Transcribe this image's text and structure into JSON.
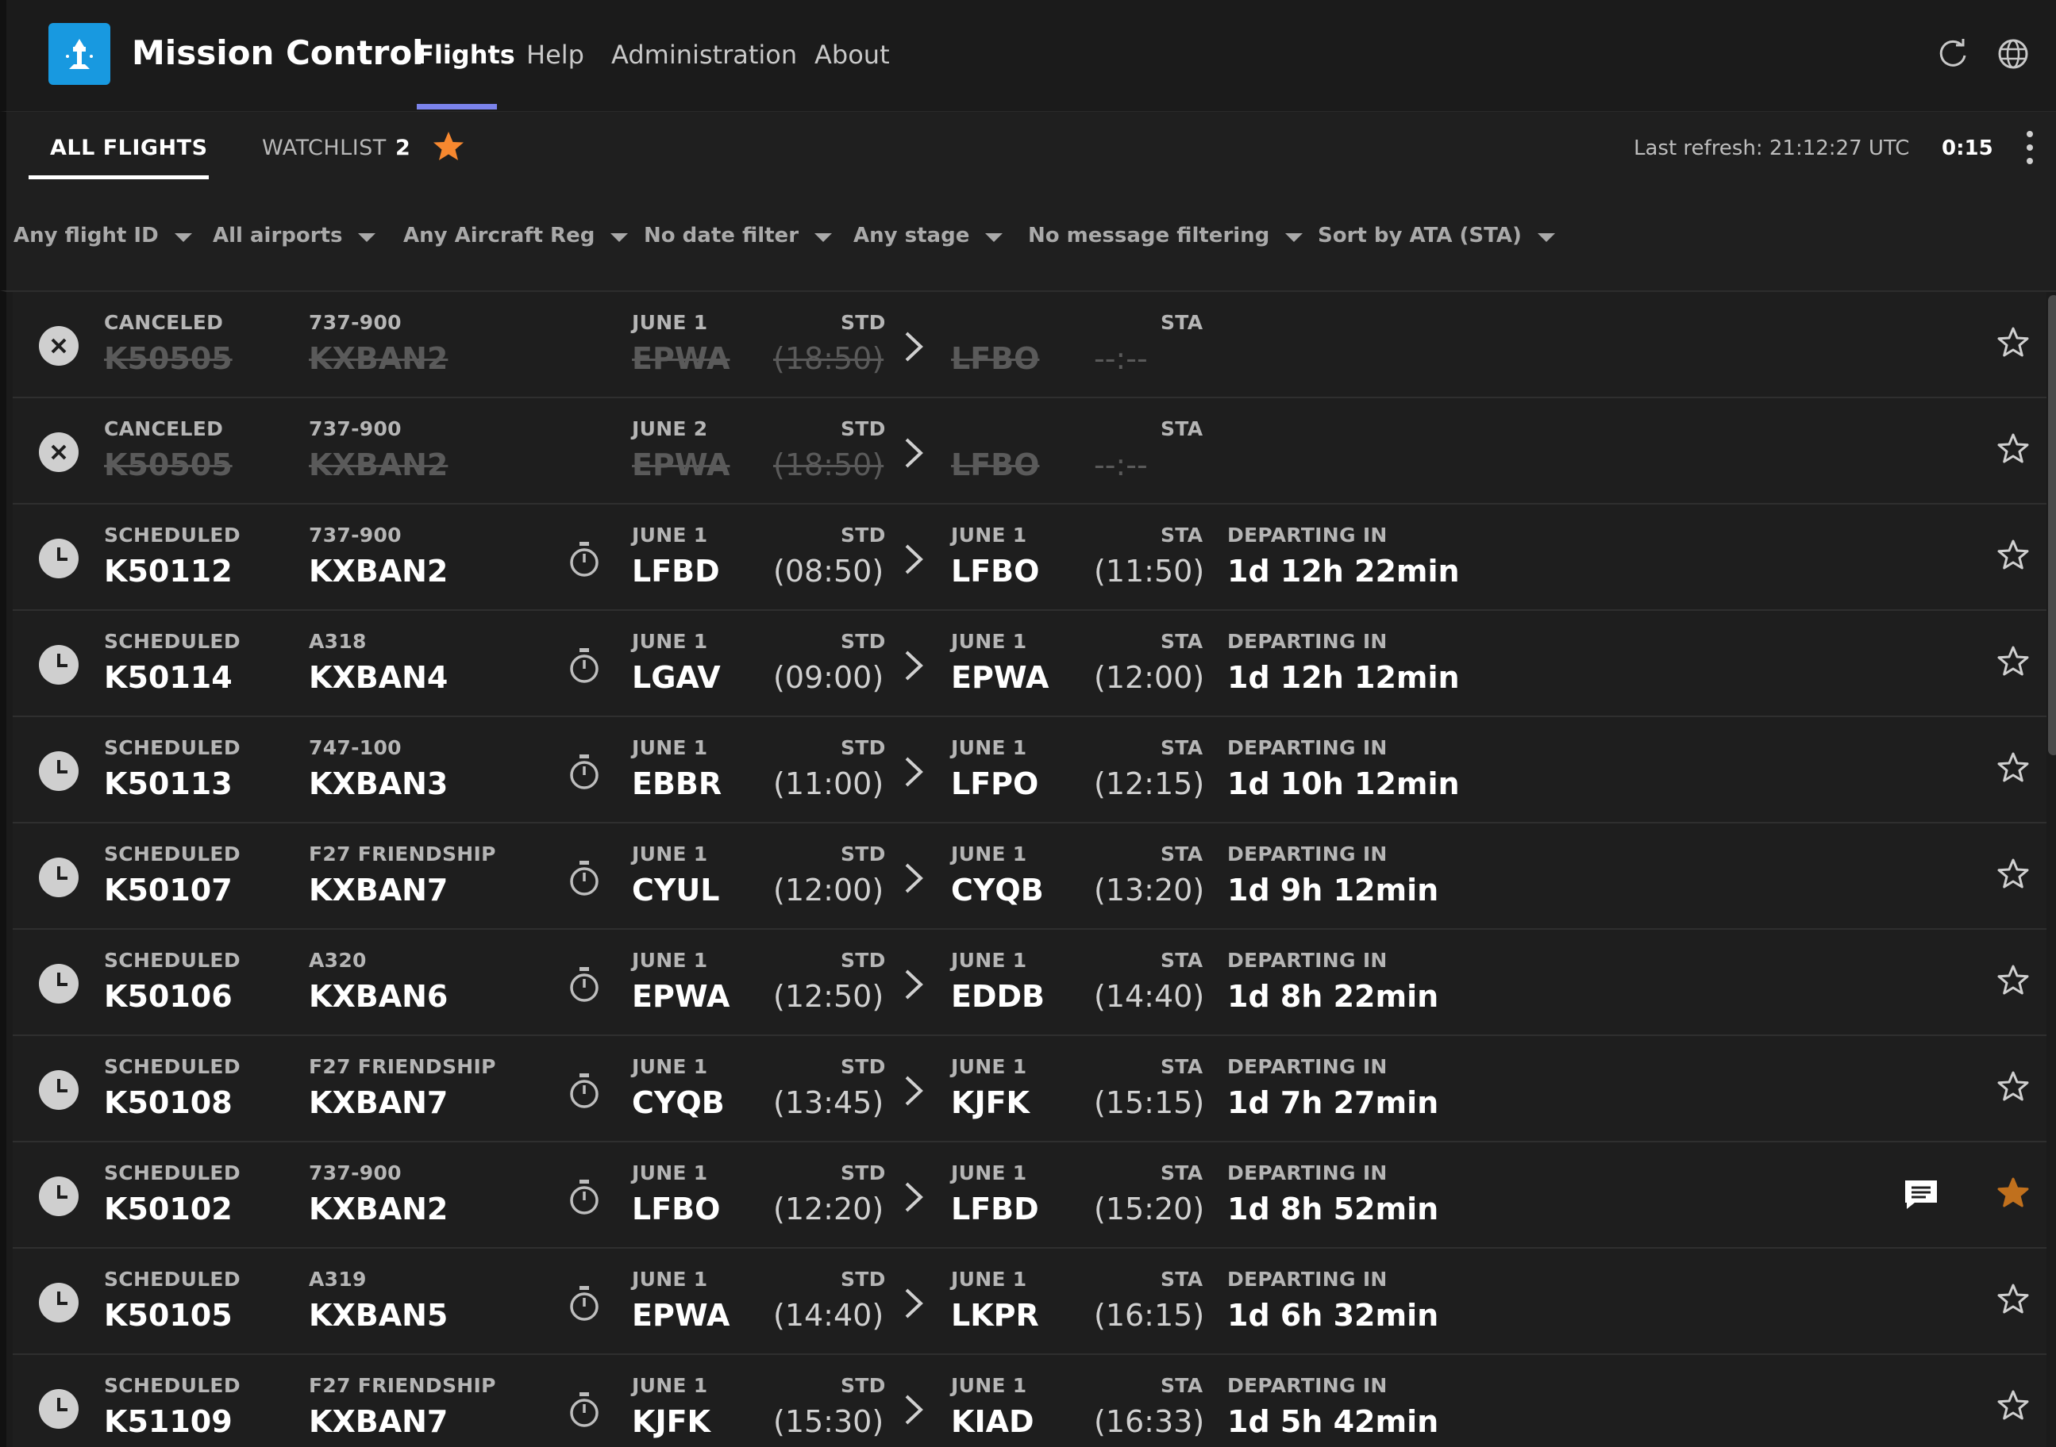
{
  "app": {
    "title": "Mission Control",
    "nav": [
      "Flights",
      "Help",
      "Administration",
      "About"
    ],
    "active_nav": "Flights"
  },
  "tabs": {
    "all_flights": "ALL FLIGHTS",
    "watchlist": "WATCHLIST",
    "watchlist_count": "2"
  },
  "refresh": {
    "label": "Last refresh: 21:12:27 UTC",
    "countdown": "0:15"
  },
  "filters": [
    "Any flight ID",
    "All airports",
    "Any Aircraft Reg",
    "No date filter",
    "Any stage",
    "No message filtering",
    "Sort by ATA (STA)"
  ],
  "labels": {
    "std": "STD",
    "sta": "STA",
    "departing_in": "DEPARTING IN"
  },
  "flights": [
    {
      "status": "CANCELED",
      "id": "K50505",
      "type": "737-900",
      "reg": "KXBAN2",
      "dep_date": "JUNE 1",
      "dep": "EPWA",
      "std": "(18:50)",
      "arr_date": "",
      "arr": "LFBO",
      "sta": "--:--",
      "countdown_label": "",
      "countdown": "",
      "watched": false,
      "message": false
    },
    {
      "status": "CANCELED",
      "id": "K50505",
      "type": "737-900",
      "reg": "KXBAN2",
      "dep_date": "JUNE 2",
      "dep": "EPWA",
      "std": "(18:50)",
      "arr_date": "",
      "arr": "LFBO",
      "sta": "--:--",
      "countdown_label": "",
      "countdown": "",
      "watched": false,
      "message": false
    },
    {
      "status": "SCHEDULED",
      "id": "K50112",
      "type": "737-900",
      "reg": "KXBAN2",
      "dep_date": "JUNE 1",
      "dep": "LFBD",
      "std": "(08:50)",
      "arr_date": "JUNE 1",
      "arr": "LFBO",
      "sta": "(11:50)",
      "countdown_label": "DEPARTING IN",
      "countdown": "1d 12h 22min",
      "watched": false,
      "message": false
    },
    {
      "status": "SCHEDULED",
      "id": "K50114",
      "type": "A318",
      "reg": "KXBAN4",
      "dep_date": "JUNE 1",
      "dep": "LGAV",
      "std": "(09:00)",
      "arr_date": "JUNE 1",
      "arr": "EPWA",
      "sta": "(12:00)",
      "countdown_label": "DEPARTING IN",
      "countdown": "1d 12h 12min",
      "watched": false,
      "message": false
    },
    {
      "status": "SCHEDULED",
      "id": "K50113",
      "type": "747-100",
      "reg": "KXBAN3",
      "dep_date": "JUNE 1",
      "dep": "EBBR",
      "std": "(11:00)",
      "arr_date": "JUNE 1",
      "arr": "LFPO",
      "sta": "(12:15)",
      "countdown_label": "DEPARTING IN",
      "countdown": "1d 10h 12min",
      "watched": false,
      "message": false
    },
    {
      "status": "SCHEDULED",
      "id": "K50107",
      "type": "F27 FRIENDSHIP",
      "reg": "KXBAN7",
      "dep_date": "JUNE 1",
      "dep": "CYUL",
      "std": "(12:00)",
      "arr_date": "JUNE 1",
      "arr": "CYQB",
      "sta": "(13:20)",
      "countdown_label": "DEPARTING IN",
      "countdown": "1d 9h 12min",
      "watched": false,
      "message": false
    },
    {
      "status": "SCHEDULED",
      "id": "K50106",
      "type": "A320",
      "reg": "KXBAN6",
      "dep_date": "JUNE 1",
      "dep": "EPWA",
      "std": "(12:50)",
      "arr_date": "JUNE 1",
      "arr": "EDDB",
      "sta": "(14:40)",
      "countdown_label": "DEPARTING IN",
      "countdown": "1d 8h 22min",
      "watched": false,
      "message": false
    },
    {
      "status": "SCHEDULED",
      "id": "K50108",
      "type": "F27 FRIENDSHIP",
      "reg": "KXBAN7",
      "dep_date": "JUNE 1",
      "dep": "CYQB",
      "std": "(13:45)",
      "arr_date": "JUNE 1",
      "arr": "KJFK",
      "sta": "(15:15)",
      "countdown_label": "DEPARTING IN",
      "countdown": "1d 7h 27min",
      "watched": false,
      "message": false
    },
    {
      "status": "SCHEDULED",
      "id": "K50102",
      "type": "737-900",
      "reg": "KXBAN2",
      "dep_date": "JUNE 1",
      "dep": "LFBO",
      "std": "(12:20)",
      "arr_date": "JUNE 1",
      "arr": "LFBD",
      "sta": "(15:20)",
      "countdown_label": "DEPARTING IN",
      "countdown": "1d 8h 52min",
      "watched": true,
      "message": true
    },
    {
      "status": "SCHEDULED",
      "id": "K50105",
      "type": "A319",
      "reg": "KXBAN5",
      "dep_date": "JUNE 1",
      "dep": "EPWA",
      "std": "(14:40)",
      "arr_date": "JUNE 1",
      "arr": "LKPR",
      "sta": "(16:15)",
      "countdown_label": "DEPARTING IN",
      "countdown": "1d 6h 32min",
      "watched": false,
      "message": false
    },
    {
      "status": "SCHEDULED",
      "id": "K51109",
      "type": "F27 FRIENDSHIP",
      "reg": "KXBAN7",
      "dep_date": "JUNE 1",
      "dep": "KJFK",
      "std": "(15:30)",
      "arr_date": "JUNE 1",
      "arr": "KIAD",
      "sta": "(16:33)",
      "countdown_label": "DEPARTING IN",
      "countdown": "1d 5h 42min",
      "watched": false,
      "message": false
    }
  ],
  "colors": {
    "accent": "#7b83eb",
    "logo": "#1899e0",
    "star_active": "#f7882f",
    "star_watched": "#c0701d"
  },
  "icons": {
    "logo": "control-tower-icon",
    "refresh": "refresh-icon",
    "language": "globe-icon",
    "watchlist": "star-icon",
    "more": "more-vertical-icon",
    "canceled": "cancel-circle-icon",
    "scheduled": "clock-icon",
    "timer": "stopwatch-icon",
    "route": "chevron-right-icon",
    "message": "message-icon",
    "watch": "star-outline-icon"
  }
}
